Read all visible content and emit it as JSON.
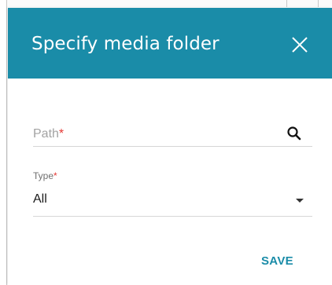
{
  "dialog": {
    "title": "Specify media folder",
    "close_icon": "close-icon",
    "save_label": "SAVE"
  },
  "path_field": {
    "label": "Path",
    "required_mark": "*",
    "icon": "search-icon",
    "value": ""
  },
  "type_field": {
    "label": "Type",
    "required_mark": "*",
    "value": "All",
    "icon": "dropdown-arrow-icon"
  },
  "colors": {
    "header": "#1a8ca8",
    "accent": "#1a8ca8",
    "required": "#e53935",
    "field_border": "#d6d6d6"
  }
}
